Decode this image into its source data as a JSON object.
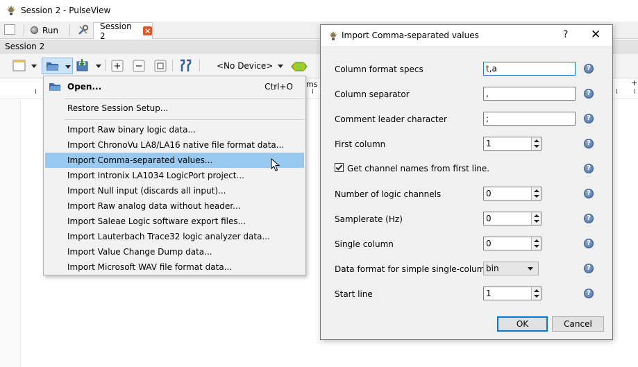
{
  "window": {
    "title": "Session 2 - PulseView"
  },
  "tabbar": {
    "run_label": "Run",
    "session_tab_label": "Session 2"
  },
  "session_header": {
    "label": "Session 2"
  },
  "toolbar": {
    "device_label": "<No Device>"
  },
  "ruler": {
    "label_left": "ms",
    "label_right": "+"
  },
  "menu": {
    "open": {
      "label": "Open...",
      "shortcut": "Ctrl+O"
    },
    "restore_label": "Restore Session Setup...",
    "items": [
      "Import Raw binary logic data...",
      "Import ChronoVu LA8/LA16 native file format data...",
      "Import Comma-separated values...",
      "Import Intronix LA1034 LogicPort project...",
      "Import Null input (discards all input)...",
      "Import Raw analog data without header...",
      "Import Saleae Logic software export files...",
      "Import Lauterbach Trace32 logic analyzer data...",
      "Import Value Change Dump data...",
      "Import Microsoft WAV file format data..."
    ],
    "highlighted_index": 2
  },
  "dialog": {
    "title": "Import Comma-separated values",
    "help_glyph": "?",
    "close_glyph": "✕",
    "fields": {
      "column_format": {
        "label": "Column format specs",
        "value": "t,a"
      },
      "column_separator": {
        "label": "Column separator",
        "value": ","
      },
      "comment_leader": {
        "label": "Comment leader character",
        "value": ";"
      },
      "first_column": {
        "label": "First column",
        "value": "1"
      },
      "header_checkbox": {
        "label": "Get channel names from first line.",
        "checked": true
      },
      "logic_channels": {
        "label": "Number of logic channels",
        "value": "0"
      },
      "samplerate": {
        "label": "Samplerate (Hz)",
        "value": "0"
      },
      "single_column": {
        "label": "Single column",
        "value": "0"
      },
      "data_format": {
        "label": "Data format for simple single-column mode.",
        "value": "bin"
      },
      "start_line": {
        "label": "Start line",
        "value": "1"
      }
    },
    "ok_label": "OK",
    "cancel_label": "Cancel"
  },
  "colors": {
    "highlight": "#99c9ef",
    "accent": "#0078d7",
    "help_icon": "#4a6fa8"
  }
}
